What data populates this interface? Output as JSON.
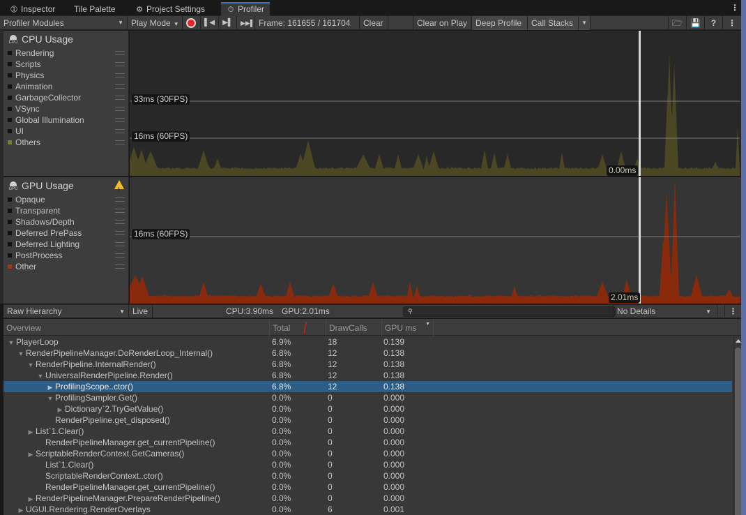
{
  "tabs": [
    {
      "label": "Inspector",
      "icon": "info-icon",
      "active": false
    },
    {
      "label": "Tile Palette",
      "icon": "",
      "active": false
    },
    {
      "label": "Project Settings",
      "icon": "gear-icon",
      "active": false
    },
    {
      "label": "Profiler",
      "icon": "stopwatch-icon",
      "active": true
    }
  ],
  "toolbar": {
    "modules_label": "Profiler Modules",
    "target_label": "Play Mode",
    "frame_label": "Frame: 161655 / 161704",
    "clear_label": "Clear",
    "clear_on_play_label": "Clear on Play",
    "deep_profile_label": "Deep Profile",
    "call_stacks_label": "Call Stacks"
  },
  "cpu_module": {
    "title": "CPU Usage",
    "chip_text": "CPU",
    "legend": [
      {
        "label": "Rendering",
        "color": "#111111"
      },
      {
        "label": "Scripts",
        "color": "#111111"
      },
      {
        "label": "Physics",
        "color": "#111111"
      },
      {
        "label": "Animation",
        "color": "#111111"
      },
      {
        "label": "GarbageCollector",
        "color": "#111111"
      },
      {
        "label": "VSync",
        "color": "#111111"
      },
      {
        "label": "Global Illumination",
        "color": "#111111"
      },
      {
        "label": "UI",
        "color": "#111111"
      },
      {
        "label": "Others",
        "color": "#7b7a2a"
      }
    ],
    "ref_lines": [
      "33ms (30FPS)",
      "16ms (60FPS)"
    ],
    "cursor_value": "0.00ms",
    "fill_color": "#4a4722"
  },
  "gpu_module": {
    "title": "GPU Usage",
    "chip_text": "GPU",
    "has_warning": true,
    "legend": [
      {
        "label": "Opaque",
        "color": "#111111"
      },
      {
        "label": "Transparent",
        "color": "#111111"
      },
      {
        "label": "Shadows/Depth",
        "color": "#111111"
      },
      {
        "label": "Deferred PrePass",
        "color": "#111111"
      },
      {
        "label": "Deferred Lighting",
        "color": "#111111"
      },
      {
        "label": "PostProcess",
        "color": "#111111"
      },
      {
        "label": "Other",
        "color": "#a8351a"
      }
    ],
    "ref_lines": [
      "16ms (60FPS)"
    ],
    "cursor_value": "2.01ms",
    "fill_color": "#8a2a0c"
  },
  "hierarchy_toolbar": {
    "view_label": "Raw Hierarchy",
    "live_label": "Live",
    "cpu_time": "CPU:3.90ms",
    "gpu_time": "GPU:2.01ms",
    "search_placeholder": "",
    "details_label": "No Details"
  },
  "table": {
    "columns": [
      "Overview",
      "Total",
      "DrawCalls",
      "GPU ms"
    ],
    "rows": [
      {
        "name": "PlayerLoop",
        "depth": 0,
        "toggle": "open",
        "total": "6.9%",
        "drawcalls": "18",
        "gpu": "0.139",
        "selected": false
      },
      {
        "name": "RenderPipelineManager.DoRenderLoop_Internal()",
        "depth": 1,
        "toggle": "open",
        "total": "6.8%",
        "drawcalls": "12",
        "gpu": "0.138",
        "selected": false
      },
      {
        "name": "RenderPipeline.InternalRender()",
        "depth": 2,
        "toggle": "open",
        "total": "6.8%",
        "drawcalls": "12",
        "gpu": "0.138",
        "selected": false
      },
      {
        "name": "UniversalRenderPipeline.Render()",
        "depth": 3,
        "toggle": "open",
        "total": "6.8%",
        "drawcalls": "12",
        "gpu": "0.138",
        "selected": false
      },
      {
        "name": "ProfilingScope..ctor()",
        "depth": 4,
        "toggle": "closed",
        "total": "6.8%",
        "drawcalls": "12",
        "gpu": "0.138",
        "selected": true
      },
      {
        "name": "ProfilingSampler.Get()",
        "depth": 4,
        "toggle": "open",
        "total": "0.0%",
        "drawcalls": "0",
        "gpu": "0.000",
        "selected": false
      },
      {
        "name": "Dictionary`2.TryGetValue()",
        "depth": 5,
        "toggle": "closed",
        "total": "0.0%",
        "drawcalls": "0",
        "gpu": "0.000",
        "selected": false
      },
      {
        "name": "RenderPipeline.get_disposed()",
        "depth": 4,
        "toggle": "none",
        "total": "0.0%",
        "drawcalls": "0",
        "gpu": "0.000",
        "selected": false
      },
      {
        "name": "List`1.Clear()",
        "depth": 2,
        "toggle": "closed",
        "total": "0.0%",
        "drawcalls": "0",
        "gpu": "0.000",
        "selected": false
      },
      {
        "name": "RenderPipelineManager.get_currentPipeline()",
        "depth": 3,
        "toggle": "none",
        "total": "0.0%",
        "drawcalls": "0",
        "gpu": "0.000",
        "selected": false
      },
      {
        "name": "ScriptableRenderContext.GetCameras()",
        "depth": 2,
        "toggle": "closed",
        "total": "0.0%",
        "drawcalls": "0",
        "gpu": "0.000",
        "selected": false
      },
      {
        "name": "List`1.Clear()",
        "depth": 3,
        "toggle": "none",
        "total": "0.0%",
        "drawcalls": "0",
        "gpu": "0.000",
        "selected": false
      },
      {
        "name": "ScriptableRenderContext..ctor()",
        "depth": 3,
        "toggle": "none",
        "total": "0.0%",
        "drawcalls": "0",
        "gpu": "0.000",
        "selected": false
      },
      {
        "name": "RenderPipelineManager.get_currentPipeline()",
        "depth": 3,
        "toggle": "none",
        "total": "0.0%",
        "drawcalls": "0",
        "gpu": "0.000",
        "selected": false
      },
      {
        "name": "RenderPipelineManager.PrepareRenderPipeline()",
        "depth": 2,
        "toggle": "closed",
        "total": "0.0%",
        "drawcalls": "0",
        "gpu": "0.000",
        "selected": false
      },
      {
        "name": "UGUI.Rendering.RenderOverlays",
        "depth": 1,
        "toggle": "closed",
        "total": "0.0%",
        "drawcalls": "6",
        "gpu": "0.001",
        "selected": false
      }
    ]
  },
  "colors": {
    "selection": "#2c5d87",
    "tab_accent": "#3a79bb",
    "cpu_others": "#4a4722",
    "gpu_other": "#8a2a0c"
  }
}
